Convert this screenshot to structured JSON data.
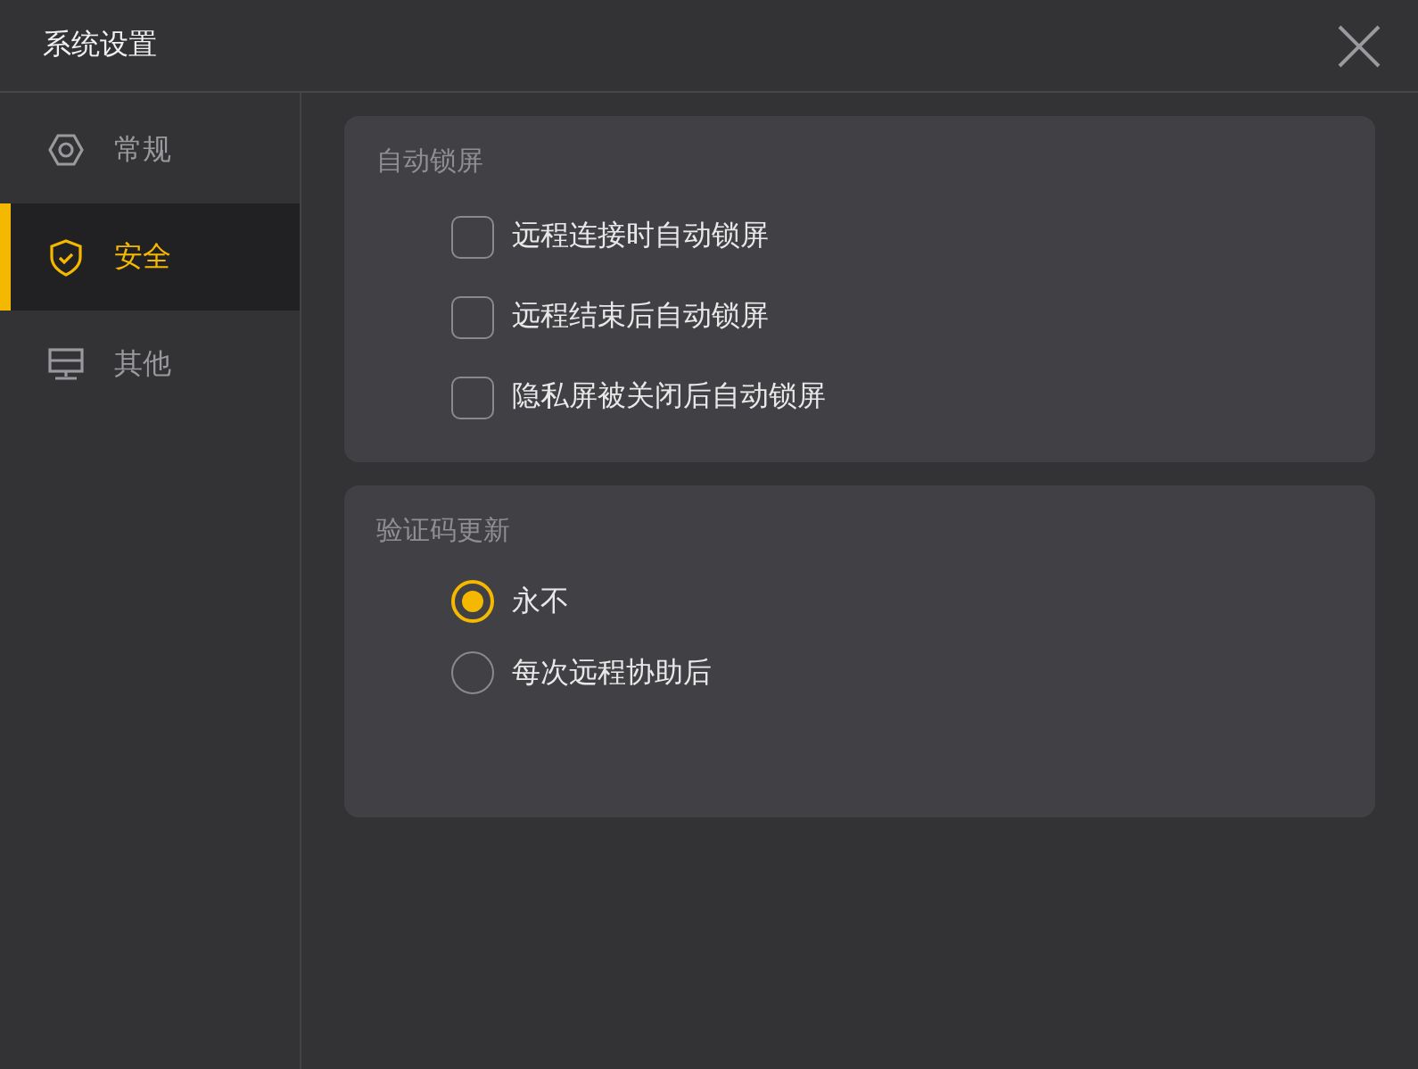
{
  "window": {
    "title": "系统设置"
  },
  "sidebar": {
    "items": [
      {
        "label": "常规",
        "selected": false
      },
      {
        "label": "安全",
        "selected": true
      },
      {
        "label": "其他",
        "selected": false
      }
    ]
  },
  "sections": [
    {
      "title": "自动锁屏",
      "kind": "checkbox",
      "options": [
        {
          "label": "远程连接时自动锁屏",
          "checked": false
        },
        {
          "label": "远程结束后自动锁屏",
          "checked": false
        },
        {
          "label": "隐私屏被关闭后自动锁屏",
          "checked": false
        }
      ]
    },
    {
      "title": "验证码更新",
      "kind": "radio",
      "options": [
        {
          "label": "永不",
          "selected": true
        },
        {
          "label": "每次远程协助后",
          "selected": false
        }
      ]
    }
  ]
}
